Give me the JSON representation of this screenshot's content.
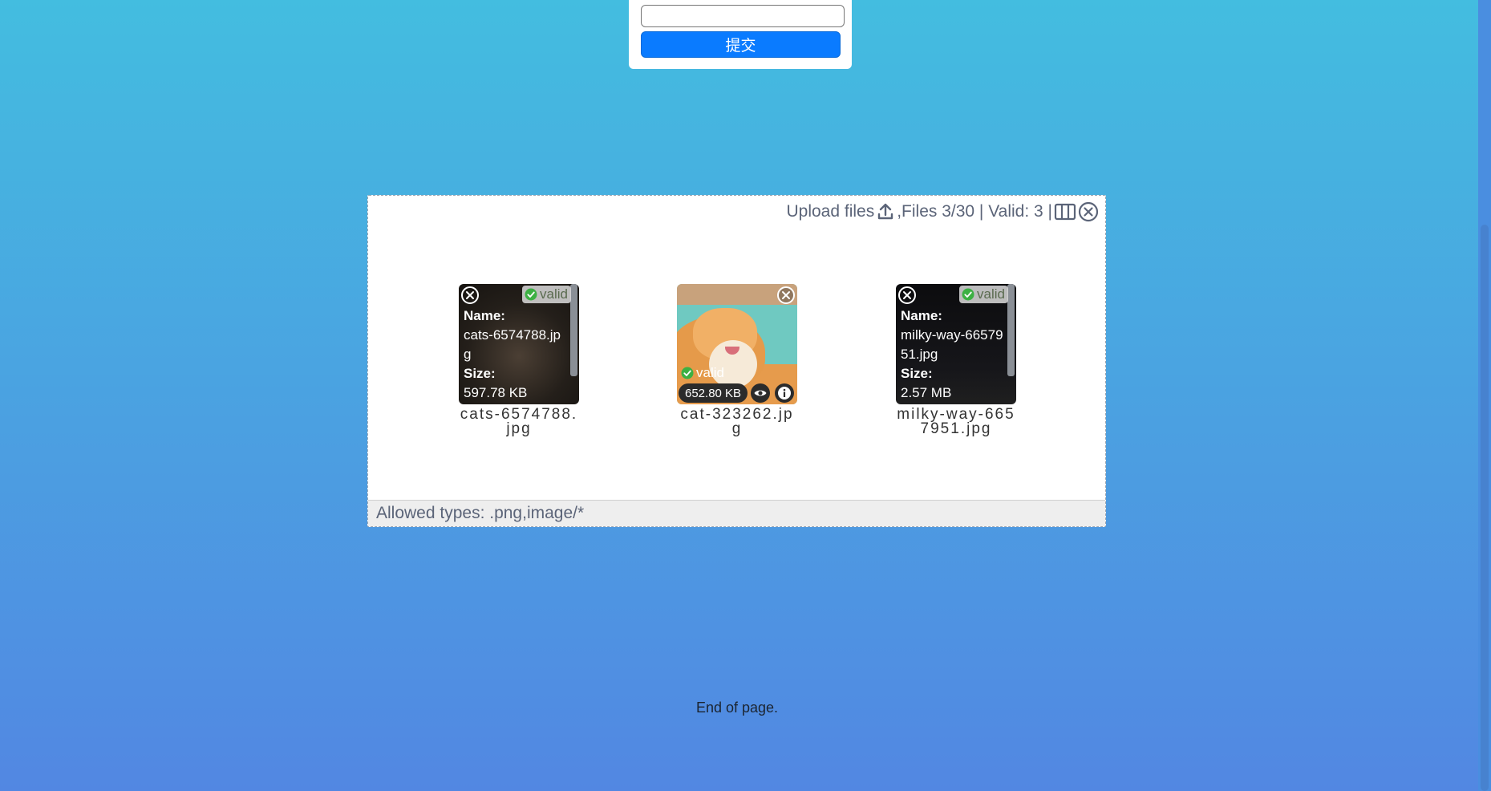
{
  "form": {
    "input_value": "",
    "submit_label": "提交"
  },
  "uploader": {
    "upload_label": "Upload files",
    "files_status": ",Files 3/30 | Valid: 3 |",
    "allowed_types": "Allowed types: .png,image/*",
    "files": [
      {
        "name": "cats-6574788.jpg",
        "size": "597.78 KB",
        "valid_label": "valid",
        "name_label": "Name:",
        "size_label": "Size:",
        "info_name": "cats-6574788.jpg",
        "info_size": "597.78 KB"
      },
      {
        "name": "cat-323262.jpg",
        "size": "652.80 KB",
        "valid_label": "valid"
      },
      {
        "name": "milky-way-6657951.jpg",
        "size": "2.57 MB",
        "valid_label": "valid",
        "name_label": "Name:",
        "size_label": "Size:",
        "info_name": "milky-way-6657951.jpg",
        "info_size": "2.57 MB"
      }
    ]
  },
  "footer": {
    "end_text": "End of page."
  },
  "colors": {
    "accent": "#0a7bff",
    "valid_green": "#3cb043",
    "text_muted": "#5b6478"
  }
}
